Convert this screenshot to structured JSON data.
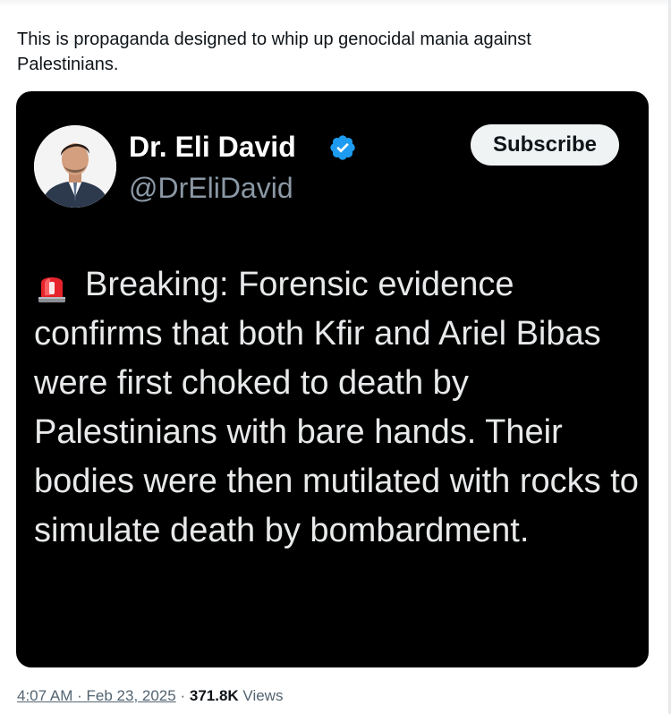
{
  "tweet": {
    "text": "This is propaganda designed to whip up genocidal mania against Palestinians."
  },
  "embedded_post": {
    "author_name": "Dr. Eli David",
    "author_handle": "@DrEliDavid",
    "subscribe_label": "Subscribe",
    "verified_icon": "verified-badge-icon",
    "verified_color": "#1d9bf0",
    "body_icon": "police-siren-icon",
    "body_text": "Breaking: Forensic evidence confirms that both Kfir and Ariel Bibas were first choked to death by Palestinians with bare hands. Their bodies were then mutilated with rocks to simulate death by bombardment.",
    "background_color": "#000000"
  },
  "meta": {
    "time": "4:07 AM",
    "separator_1": "·",
    "date": "Feb 23, 2025",
    "separator_2": "·",
    "views_count": "371.8K",
    "views_label": "Views"
  }
}
